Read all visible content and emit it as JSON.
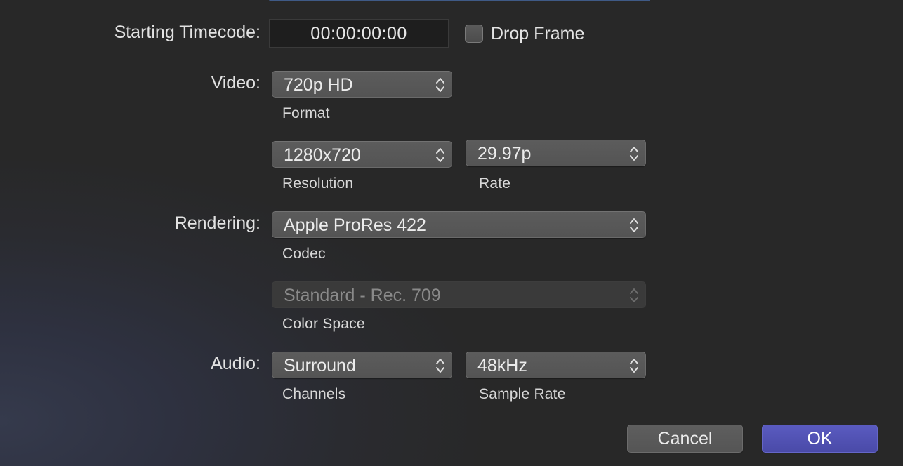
{
  "dialog": {
    "timecode": {
      "label": "Starting Timecode:",
      "value": "00:00:00:00",
      "drop_frame_label": "Drop Frame",
      "drop_frame_checked": false
    },
    "video": {
      "label": "Video:",
      "format": {
        "value": "720p HD",
        "caption": "Format"
      },
      "resolution": {
        "value": "1280x720",
        "caption": "Resolution"
      },
      "rate": {
        "value": "29.97p",
        "caption": "Rate"
      }
    },
    "rendering": {
      "label": "Rendering:",
      "codec": {
        "value": "Apple ProRes 422",
        "caption": "Codec"
      },
      "color_space": {
        "value": "Standard - Rec. 709",
        "caption": "Color Space",
        "enabled": false
      }
    },
    "audio": {
      "label": "Audio:",
      "channels": {
        "value": "Surround",
        "caption": "Channels"
      },
      "sample_rate": {
        "value": "48kHz",
        "caption": "Sample Rate"
      }
    },
    "buttons": {
      "cancel_label": "Cancel",
      "ok_label": "OK"
    },
    "colors": {
      "background": "#282828",
      "accent": "#4f50b4",
      "popup": "#585858"
    }
  }
}
